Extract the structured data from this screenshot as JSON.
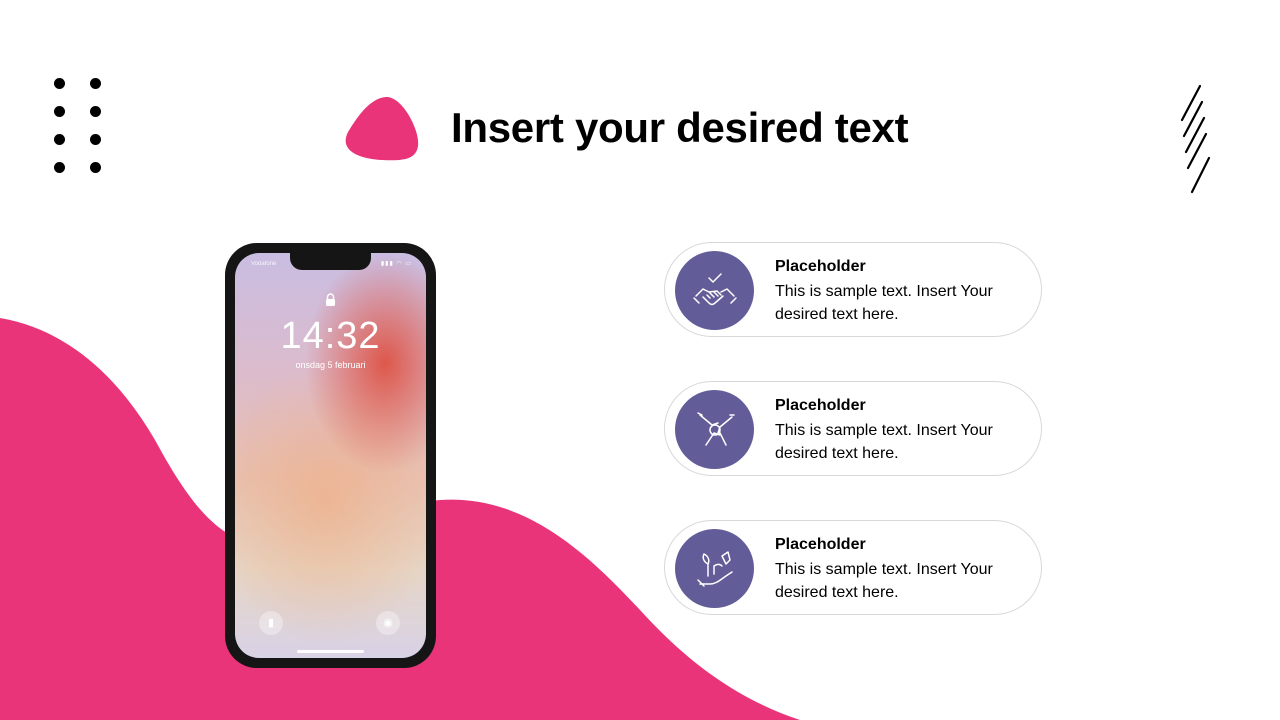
{
  "slide": {
    "title": "Insert your desired text",
    "accent_color": "#ea3479",
    "icon_color": "#625d98"
  },
  "phone": {
    "carrier": "Vodafone",
    "status_icons": "▮▮▮ ◠ ▭",
    "time": "14:32",
    "date": "onsdag 5 februari",
    "flashlight_icon": "flashlight-icon",
    "camera_icon": "camera-icon"
  },
  "items": [
    {
      "title": "Placeholder",
      "text": "This is sample text.  Insert Your desired text here.",
      "icon": "handshake-icon"
    },
    {
      "title": "Placeholder",
      "text": "This is sample text.  Insert Your desired text here.",
      "icon": "teamwork-hands-icon"
    },
    {
      "title": "Placeholder",
      "text": "This is sample text.  Insert Your desired text here.",
      "icon": "growth-plant-icon"
    }
  ]
}
